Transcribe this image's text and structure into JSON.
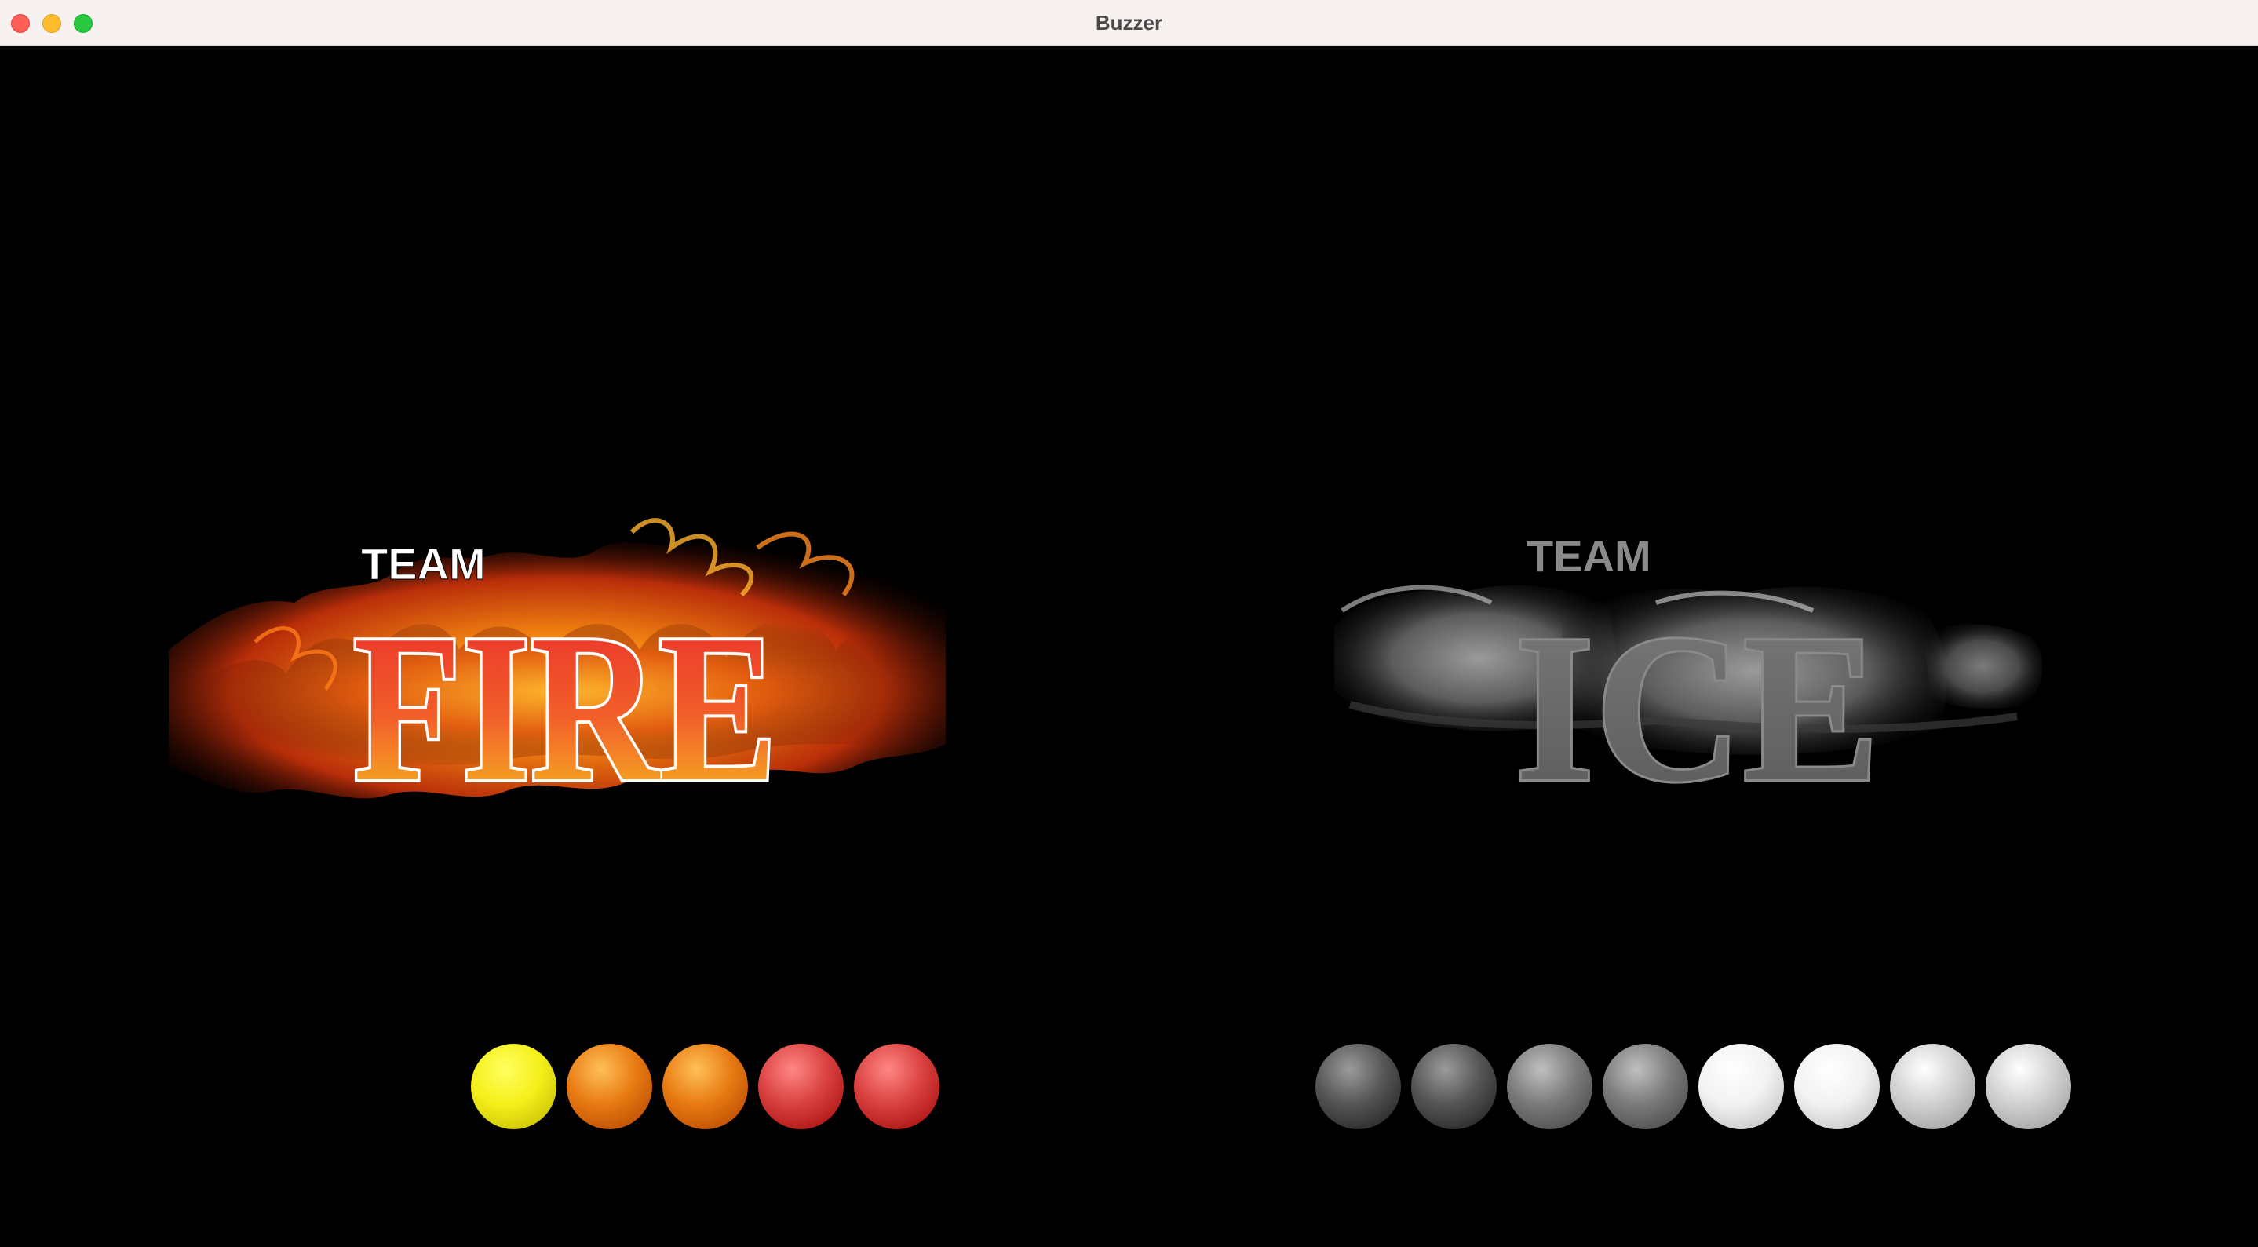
{
  "window": {
    "title": "Buzzer"
  },
  "teams": [
    {
      "name": "fire",
      "logo_text_small": "TEAM",
      "logo_text_large": "FIRE",
      "lights": [
        {
          "state": "active",
          "color": "#f5ef1a"
        },
        {
          "state": "active",
          "color": "#e87a12"
        },
        {
          "state": "active",
          "color": "#e87a12"
        },
        {
          "state": "active",
          "color": "#d8413f"
        },
        {
          "state": "active",
          "color": "#d8413f"
        }
      ]
    },
    {
      "name": "ice",
      "logo_text_small": "TEAM",
      "logo_text_large": "ICE",
      "lights": [
        {
          "state": "inactive",
          "color": "#555555"
        },
        {
          "state": "inactive",
          "color": "#555555"
        },
        {
          "state": "inactive",
          "color": "#7a7a7a"
        },
        {
          "state": "inactive",
          "color": "#7a7a7a"
        },
        {
          "state": "inactive",
          "color": "#f2f2f2"
        },
        {
          "state": "inactive",
          "color": "#f2f2f2"
        },
        {
          "state": "inactive",
          "color": "#d0d0d0"
        },
        {
          "state": "inactive",
          "color": "#d0d0d0"
        }
      ]
    }
  ],
  "colors": {
    "background": "#000000",
    "titlebar": "#f7f2f0",
    "fire_gradient_top": "#e8282a",
    "fire_gradient_bottom": "#f5c61a",
    "ice_text": "#6e6e6e"
  }
}
